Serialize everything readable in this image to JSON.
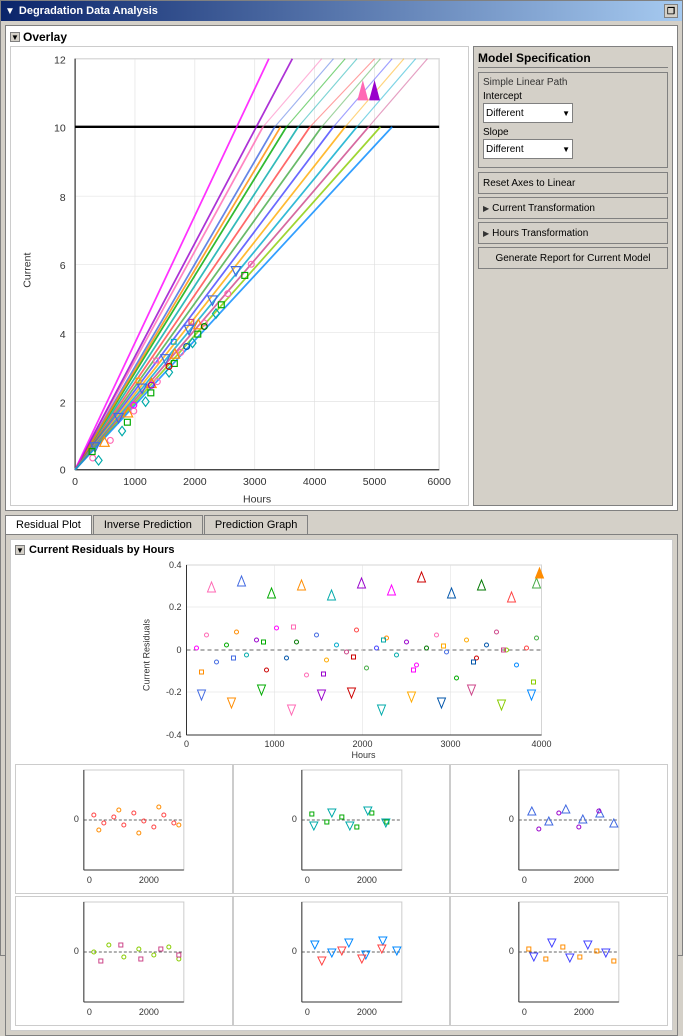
{
  "window": {
    "title": "Degradation Data Analysis",
    "restore_button": "❐"
  },
  "overlay": {
    "title": "Overlay"
  },
  "model_spec": {
    "title": "Model Specification",
    "simple_linear_label": "Simple Linear Path",
    "intercept_label": "Intercept",
    "slope_label": "Slope",
    "intercept_value": "Different",
    "slope_value": "Different",
    "reset_button": "Reset Axes to Linear",
    "current_transform_label": "Current Transformation",
    "hours_transform_label": "Hours Transformation",
    "generate_button": "Generate Report for Current Model"
  },
  "tabs": {
    "items": [
      {
        "label": "Residual Plot",
        "active": true
      },
      {
        "label": "Inverse Prediction",
        "active": false
      },
      {
        "label": "Prediction Graph",
        "active": false
      }
    ]
  },
  "residuals": {
    "title": "Current Residuals by Hours"
  },
  "chart": {
    "main": {
      "y_label": "Current",
      "x_label": "Hours",
      "y_min": 0,
      "y_max": 12,
      "x_max": 6000,
      "threshold": 10
    },
    "residuals": {
      "y_label": "Current Residuals",
      "x_label": "Hours",
      "y_min": -0.4,
      "y_max": 0.4,
      "x_max": 4000
    }
  }
}
